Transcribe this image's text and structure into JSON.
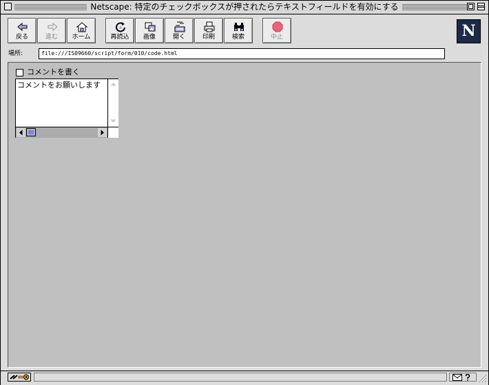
{
  "window": {
    "title": "Netscape: 特定のチェックボックスが押されたらテキストフィールドを有効にする"
  },
  "toolbar": {
    "buttons": [
      {
        "label": "戻る",
        "icon": "back-arrow-icon",
        "enabled": true
      },
      {
        "label": "進む",
        "icon": "forward-arrow-icon",
        "enabled": false
      },
      {
        "label": "ホーム",
        "icon": "home-icon",
        "enabled": true
      },
      {
        "label": "再読込",
        "icon": "reload-icon",
        "enabled": true
      },
      {
        "label": "画像",
        "icon": "images-icon",
        "enabled": true
      },
      {
        "label": "開く",
        "icon": "open-icon",
        "enabled": true
      },
      {
        "label": "印刷",
        "icon": "print-icon",
        "enabled": true
      },
      {
        "label": "検索",
        "icon": "search-binoculars-icon",
        "enabled": true
      },
      {
        "label": "中止",
        "icon": "stop-icon",
        "enabled": false
      }
    ],
    "logo": "N"
  },
  "location": {
    "label": "場所:",
    "url": "file:///IS09660/script/form/010/code.html"
  },
  "page": {
    "checkbox_label": "コメントを書く",
    "checkbox_checked": false,
    "textarea_text": "コメントをお願いします"
  },
  "colors": {
    "accent": "#b0aee8",
    "content_bg": "#c0c0c0",
    "stop": "#e8637a"
  }
}
